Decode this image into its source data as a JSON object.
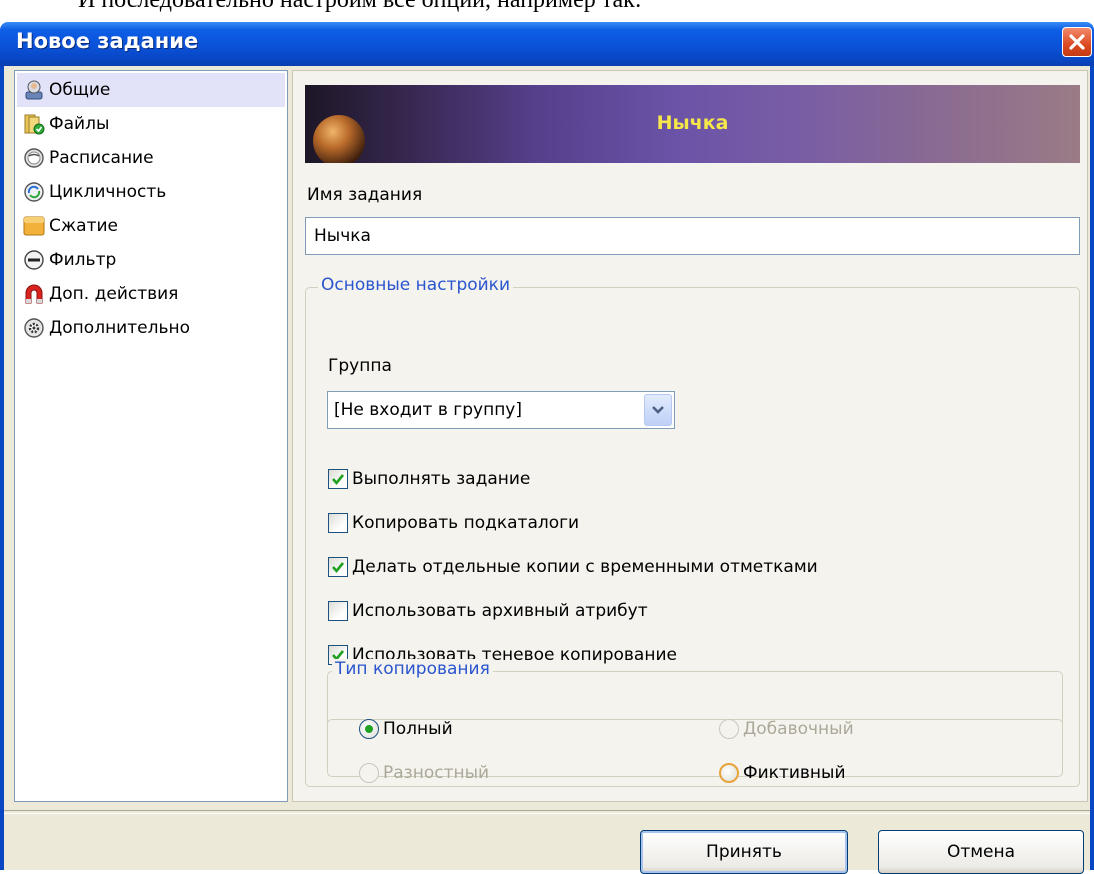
{
  "document": {
    "caption": "И последовательно настроим все опции, например так:"
  },
  "window": {
    "title": "Новое задание"
  },
  "sidebar": {
    "items": [
      {
        "label": "Общие",
        "icon": "user-general-icon",
        "selected": true
      },
      {
        "label": "Файлы",
        "icon": "files-icon",
        "selected": false
      },
      {
        "label": "Расписание",
        "icon": "clock-icon",
        "selected": false
      },
      {
        "label": "Цикличность",
        "icon": "cycle-icon",
        "selected": false
      },
      {
        "label": "Сжатие",
        "icon": "compression-icon",
        "selected": false
      },
      {
        "label": "Фильтр",
        "icon": "filter-icon",
        "selected": false
      },
      {
        "label": "Доп. действия",
        "icon": "magnet-icon",
        "selected": false
      },
      {
        "label": "Дополнительно",
        "icon": "gear-icon",
        "selected": false
      }
    ]
  },
  "main": {
    "banner_title": "Нычка",
    "job_name_label": "Имя задания",
    "job_name_value": "Нычка",
    "basic_settings": {
      "legend": "Основные настройки",
      "group_label": "Группа",
      "group_value": "[Не входит в группу]",
      "checkboxes": [
        {
          "label": "Выполнять задание",
          "checked": true
        },
        {
          "label": "Копировать подкаталоги",
          "checked": false
        },
        {
          "label": "Делать отдельные копии с временными отметками",
          "checked": true
        },
        {
          "label": "Использовать архивный атрибут",
          "checked": false
        },
        {
          "label": "Использовать теневое копирование",
          "checked": true
        }
      ]
    },
    "copy_type": {
      "legend": "Тип копирования",
      "options": [
        {
          "label": "Полный",
          "selected": true,
          "enabled": true
        },
        {
          "label": "Добавочный",
          "selected": false,
          "enabled": false
        },
        {
          "label": "Разностный",
          "selected": false,
          "enabled": false
        },
        {
          "label": "Фиктивный",
          "selected": false,
          "enabled": true
        }
      ]
    }
  },
  "buttons": {
    "accept": "Принять",
    "cancel": "Отмена"
  },
  "colors": {
    "titlebar": "#0a52d8",
    "legend_text": "#2a55cf",
    "banner_text": "#f5e64a",
    "check_mark": "#21a121",
    "close_button": "#dc4a22"
  }
}
